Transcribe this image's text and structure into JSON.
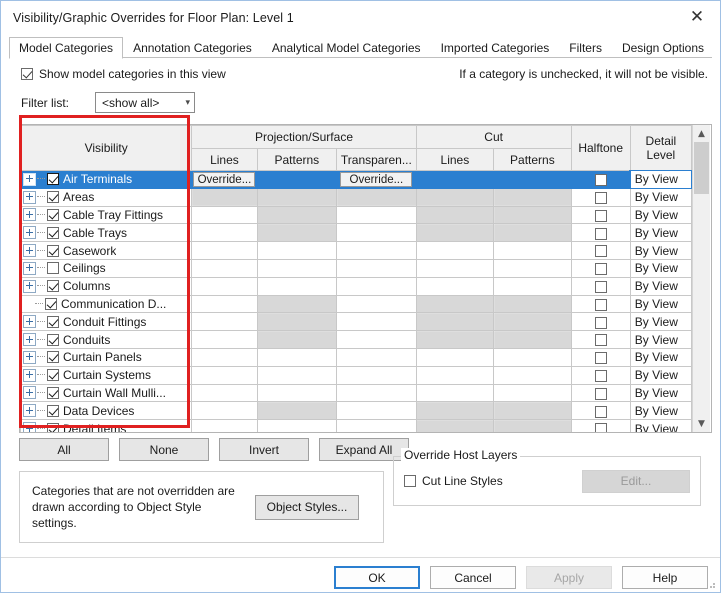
{
  "window": {
    "title": "Visibility/Graphic Overrides for Floor Plan: Level 1",
    "close_icon": "close-icon"
  },
  "tabs": [
    {
      "label": "Model Categories",
      "active": true
    },
    {
      "label": "Annotation Categories",
      "active": false
    },
    {
      "label": "Analytical Model Categories",
      "active": false
    },
    {
      "label": "Imported Categories",
      "active": false
    },
    {
      "label": "Filters",
      "active": false
    },
    {
      "label": "Design Options",
      "active": false
    }
  ],
  "options": {
    "show_model_categories_label": "Show model categories in this view",
    "show_model_categories_checked": true,
    "hint": "If a category is unchecked, it will not be visible.",
    "filter_label": "Filter list:",
    "filter_value": "<show all>",
    "filter_chevron": "chevron-down-icon"
  },
  "table": {
    "headers": {
      "visibility": "Visibility",
      "projection_surface": "Projection/Surface",
      "cut": "Cut",
      "halftone": "Halftone",
      "detail_level": "Detail Level",
      "lines": "Lines",
      "patterns": "Patterns",
      "transparency": "Transparen..."
    },
    "override_label": "Override...",
    "detail_level_value": "By View",
    "rows": [
      {
        "name": "Air Terminals",
        "checked": true,
        "expandable": true,
        "selected": true,
        "proj_lines": "Override...",
        "proj_patterns": "",
        "proj_transparency": "Override...",
        "cut_lines": "",
        "cut_patterns": "",
        "shade": [
          false,
          false,
          false,
          false,
          false
        ],
        "halftone": false,
        "detail": "By View"
      },
      {
        "name": "Areas",
        "checked": true,
        "expandable": true,
        "selected": false,
        "proj_lines": "",
        "proj_patterns": "",
        "proj_transparency": "",
        "cut_lines": "",
        "cut_patterns": "",
        "shade": [
          true,
          true,
          true,
          true,
          true
        ],
        "halftone": false,
        "detail": "By View"
      },
      {
        "name": "Cable Tray Fittings",
        "checked": true,
        "expandable": true,
        "selected": false,
        "proj_lines": "",
        "proj_patterns": "",
        "proj_transparency": "",
        "cut_lines": "",
        "cut_patterns": "",
        "shade": [
          false,
          true,
          false,
          true,
          true
        ],
        "halftone": false,
        "detail": "By View"
      },
      {
        "name": "Cable Trays",
        "checked": true,
        "expandable": true,
        "selected": false,
        "proj_lines": "",
        "proj_patterns": "",
        "proj_transparency": "",
        "cut_lines": "",
        "cut_patterns": "",
        "shade": [
          false,
          true,
          false,
          true,
          true
        ],
        "halftone": false,
        "detail": "By View"
      },
      {
        "name": "Casework",
        "checked": true,
        "expandable": true,
        "selected": false,
        "proj_lines": "",
        "proj_patterns": "",
        "proj_transparency": "",
        "cut_lines": "",
        "cut_patterns": "",
        "shade": [
          false,
          false,
          false,
          false,
          false
        ],
        "halftone": false,
        "detail": "By View"
      },
      {
        "name": "Ceilings",
        "checked": false,
        "expandable": true,
        "selected": false,
        "proj_lines": "",
        "proj_patterns": "",
        "proj_transparency": "",
        "cut_lines": "",
        "cut_patterns": "",
        "shade": [
          false,
          false,
          false,
          false,
          false
        ],
        "halftone": false,
        "detail": "By View"
      },
      {
        "name": "Columns",
        "checked": true,
        "expandable": true,
        "selected": false,
        "proj_lines": "",
        "proj_patterns": "",
        "proj_transparency": "",
        "cut_lines": "",
        "cut_patterns": "",
        "shade": [
          false,
          false,
          false,
          false,
          false
        ],
        "halftone": false,
        "detail": "By View"
      },
      {
        "name": "Communication D...",
        "checked": true,
        "expandable": false,
        "selected": false,
        "proj_lines": "",
        "proj_patterns": "",
        "proj_transparency": "",
        "cut_lines": "",
        "cut_patterns": "",
        "shade": [
          false,
          true,
          false,
          true,
          true
        ],
        "halftone": false,
        "detail": "By View"
      },
      {
        "name": "Conduit Fittings",
        "checked": true,
        "expandable": true,
        "selected": false,
        "proj_lines": "",
        "proj_patterns": "",
        "proj_transparency": "",
        "cut_lines": "",
        "cut_patterns": "",
        "shade": [
          false,
          true,
          false,
          true,
          true
        ],
        "halftone": false,
        "detail": "By View"
      },
      {
        "name": "Conduits",
        "checked": true,
        "expandable": true,
        "selected": false,
        "proj_lines": "",
        "proj_patterns": "",
        "proj_transparency": "",
        "cut_lines": "",
        "cut_patterns": "",
        "shade": [
          false,
          true,
          false,
          true,
          true
        ],
        "halftone": false,
        "detail": "By View"
      },
      {
        "name": "Curtain Panels",
        "checked": true,
        "expandable": true,
        "selected": false,
        "proj_lines": "",
        "proj_patterns": "",
        "proj_transparency": "",
        "cut_lines": "",
        "cut_patterns": "",
        "shade": [
          false,
          false,
          false,
          false,
          false
        ],
        "halftone": false,
        "detail": "By View"
      },
      {
        "name": "Curtain Systems",
        "checked": true,
        "expandable": true,
        "selected": false,
        "proj_lines": "",
        "proj_patterns": "",
        "proj_transparency": "",
        "cut_lines": "",
        "cut_patterns": "",
        "shade": [
          false,
          false,
          false,
          false,
          false
        ],
        "halftone": false,
        "detail": "By View"
      },
      {
        "name": "Curtain Wall Mulli...",
        "checked": true,
        "expandable": true,
        "selected": false,
        "proj_lines": "",
        "proj_patterns": "",
        "proj_transparency": "",
        "cut_lines": "",
        "cut_patterns": "",
        "shade": [
          false,
          false,
          false,
          false,
          false
        ],
        "halftone": false,
        "detail": "By View"
      },
      {
        "name": "Data Devices",
        "checked": true,
        "expandable": true,
        "selected": false,
        "proj_lines": "",
        "proj_patterns": "",
        "proj_transparency": "",
        "cut_lines": "",
        "cut_patterns": "",
        "shade": [
          false,
          true,
          false,
          true,
          true
        ],
        "halftone": false,
        "detail": "By View"
      },
      {
        "name": "Detail Items",
        "checked": true,
        "expandable": true,
        "selected": false,
        "proj_lines": "",
        "proj_patterns": "",
        "proj_transparency": "",
        "cut_lines": "",
        "cut_patterns": "",
        "shade": [
          false,
          false,
          false,
          true,
          true
        ],
        "halftone": false,
        "detail": "By View"
      }
    ],
    "scrollbar": {
      "up_icon": "chevron-up-icon",
      "down_icon": "chevron-down-icon"
    }
  },
  "actions": {
    "all": "All",
    "none": "None",
    "invert": "Invert",
    "expand_all": "Expand All"
  },
  "note": {
    "text": "Categories that are not overridden are drawn according to Object Style settings.",
    "object_styles_button": "Object Styles..."
  },
  "override_host_layers": {
    "title": "Override Host Layers",
    "cut_line_styles_label": "Cut Line Styles",
    "cut_line_styles_checked": false,
    "edit_button": "Edit...",
    "edit_disabled": true
  },
  "footer": {
    "ok": "OK",
    "cancel": "Cancel",
    "apply": "Apply",
    "apply_disabled": true,
    "help": "Help"
  },
  "colors": {
    "selection_blue": "#2b7fd0",
    "annotation_red": "#e02020",
    "header_gray": "#f0f0f0",
    "shade_gray": "#c9c9c9"
  }
}
